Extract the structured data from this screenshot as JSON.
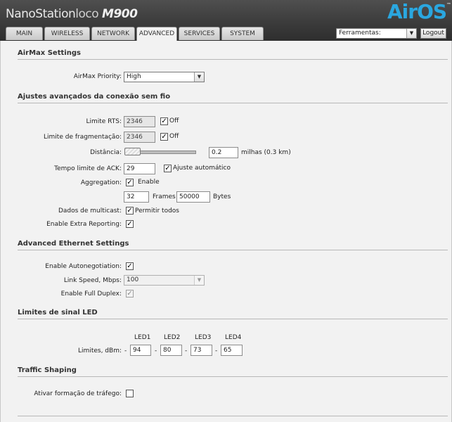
{
  "header": {
    "logo_main": "NanoStation",
    "logo_loco": "loco",
    "logo_model": "M900",
    "brand": "AirOS",
    "brand_tm": "™",
    "tabs": [
      "MAIN",
      "WIRELESS",
      "NETWORK",
      "ADVANCED",
      "SERVICES",
      "SYSTEM"
    ],
    "active_tab": "ADVANCED",
    "tools_select": "Ferramentas:",
    "logout_label": "Logout"
  },
  "airmax": {
    "title": "AirMax Settings",
    "priority_label": "AirMax Priority:",
    "priority_value": "High"
  },
  "wireless_adv": {
    "title": "Ajustes avançados da conexão sem fio",
    "rts_label": "Limite RTS:",
    "rts_value": "2346",
    "rts_off_label": "Off",
    "rts_off_checked": true,
    "frag_label": "Limite de fragmentação:",
    "frag_value": "2346",
    "frag_off_label": "Off",
    "frag_off_checked": true,
    "distance_label": "Distância:",
    "distance_value": "0.2",
    "distance_unit": "milhas (0.3 km)",
    "distance_slider_fraction": 0.0,
    "ack_label": "Tempo limite de ACK:",
    "ack_value": "29",
    "ack_auto_label": "Ajuste automático",
    "ack_auto_checked": true,
    "aggregation_label": "Aggregation:",
    "aggregation_enable_label": "Enable",
    "aggregation_checked": true,
    "frames_value": "32",
    "frames_label": "Frames",
    "bytes_value": "50000",
    "bytes_label": "Bytes",
    "multicast_label": "Dados de multicast:",
    "multicast_option_label": "Permitir todos",
    "multicast_checked": true,
    "extra_reporting_label": "Enable Extra Reporting:",
    "extra_reporting_checked": true
  },
  "ethernet": {
    "title": "Advanced Ethernet Settings",
    "autoneg_label": "Enable Autonegotiation:",
    "autoneg_checked": true,
    "link_speed_label": "Link Speed, Mbps:",
    "link_speed_value": "100",
    "full_duplex_label": "Enable Full Duplex:",
    "full_duplex_checked": true
  },
  "led": {
    "title": "Limites de sinal LED",
    "headers": [
      "LED1",
      "LED2",
      "LED3",
      "LED4"
    ],
    "limits_label": "Limites, dBm:",
    "separator": "-",
    "values": [
      "94",
      "80",
      "73",
      "65"
    ]
  },
  "traffic": {
    "title": "Traffic Shaping",
    "enable_label": "Ativar formação de tráfego:",
    "enable_checked": false
  }
}
